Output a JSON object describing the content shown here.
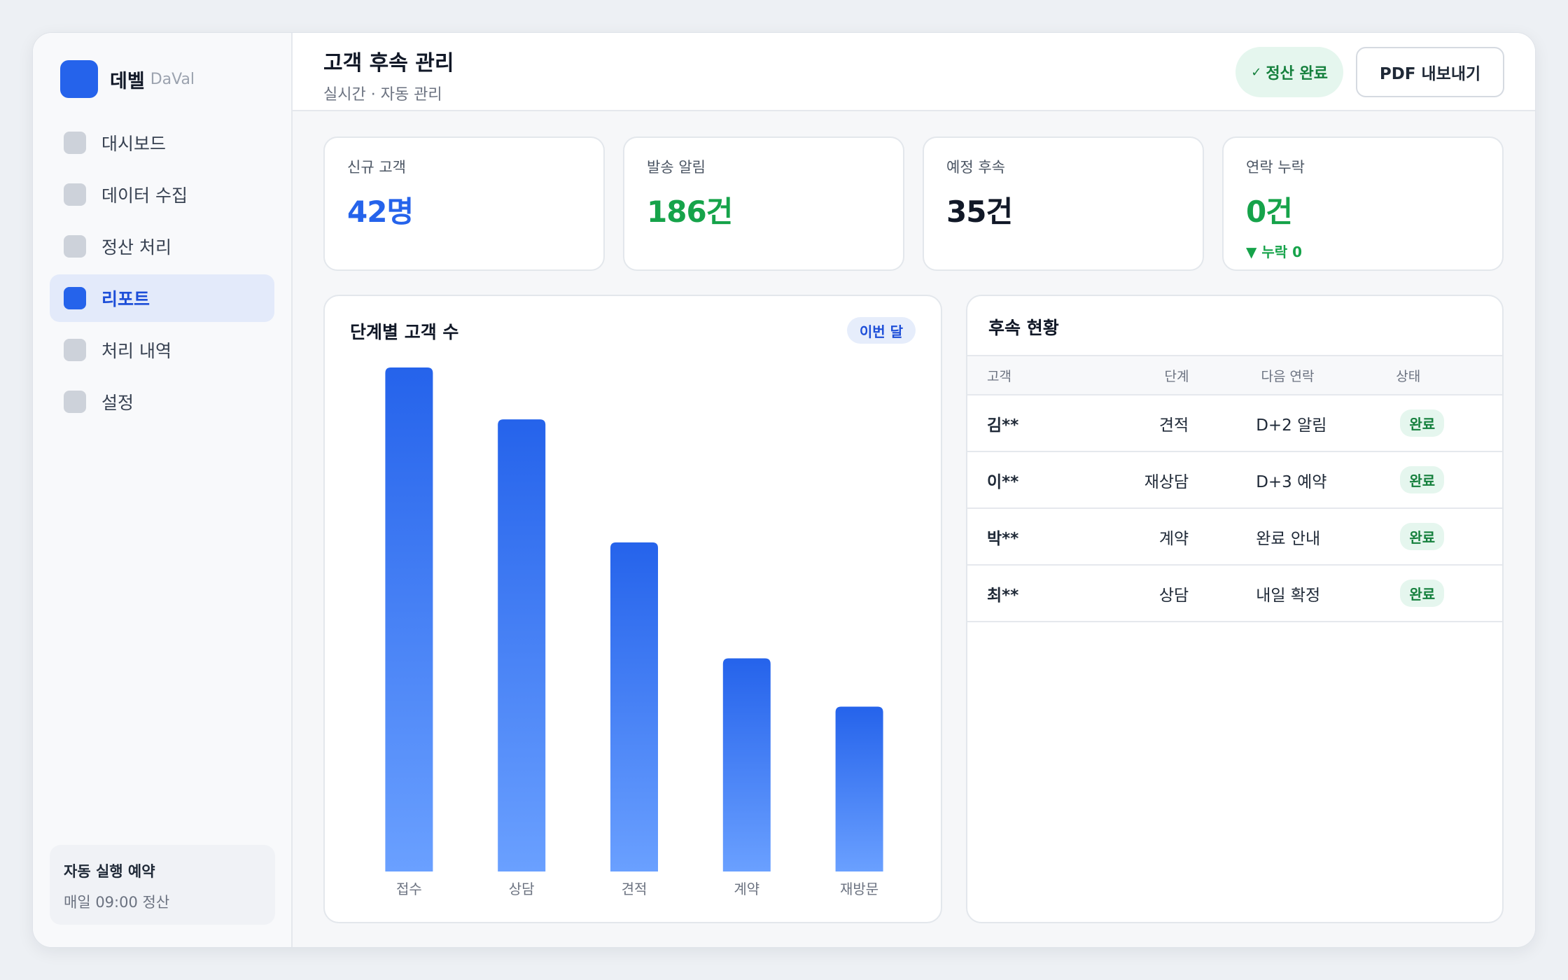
{
  "brand": {
    "name": "데벨",
    "sub": "DaVal"
  },
  "sidebar": {
    "items": [
      {
        "label": "대시보드",
        "active": false
      },
      {
        "label": "데이터 수집",
        "active": false
      },
      {
        "label": "정산 처리",
        "active": false
      },
      {
        "label": "리포트",
        "active": true
      },
      {
        "label": "처리 내역",
        "active": false
      },
      {
        "label": "설정",
        "active": false
      }
    ],
    "schedule": {
      "title": "자동 실행 예약",
      "desc": "매일 09:00 정산"
    }
  },
  "header": {
    "title": "고객 후속 관리",
    "subtitle": "실시간 · 자동 관리",
    "status_check": "✓",
    "status_label": "정산 완료",
    "export_label": "PDF 내보내기"
  },
  "stats": [
    {
      "label": "신규 고객",
      "value": "42명",
      "color": "#2563eb",
      "sub": ""
    },
    {
      "label": "발송 알림",
      "value": "186건",
      "color": "#16a34a",
      "sub": ""
    },
    {
      "label": "예정 후속",
      "value": "35건",
      "color": "#111827",
      "sub": ""
    },
    {
      "label": "연락 누락",
      "value": "0건",
      "color": "#16a34a",
      "sub": "▼ 누락 0"
    }
  ],
  "chart": {
    "title": "단계별 고객 수",
    "badge": "이번 달"
  },
  "chart_data": {
    "type": "bar",
    "title": "단계별 고객 수",
    "categories": [
      "접수",
      "상담",
      "견적",
      "계약",
      "재방문"
    ],
    "values": [
      100,
      89.7,
      65.3,
      42.3,
      32.7
    ],
    "ylim": [
      0,
      100
    ],
    "grid": false,
    "colors": {
      "top": "#2563eb",
      "bottom": "#6aa0ff"
    }
  },
  "followup": {
    "title": "후속 현황",
    "columns": [
      "고객",
      "단계",
      "다음 연락",
      "상태"
    ],
    "rows": [
      {
        "name": "김**",
        "stage": "견적",
        "next": "D+2 알림",
        "status": "완료"
      },
      {
        "name": "이**",
        "stage": "재상담",
        "next": "D+3 예약",
        "status": "완료"
      },
      {
        "name": "박**",
        "stage": "계약",
        "next": "완료 안내",
        "status": "완료"
      },
      {
        "name": "최**",
        "stage": "상담",
        "next": "내일 확정",
        "status": "완료"
      }
    ]
  }
}
